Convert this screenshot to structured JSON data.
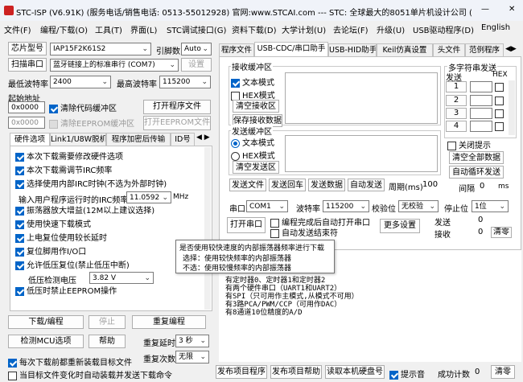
{
  "title": "STC-ISP (V6.91K) (服务电话/销售电话: 0513-55012928) 官网:www.STCAI.com  --- STC: 全球最大的8051单片机设计公司 (",
  "window_controls": {
    "min": "—",
    "max": "☐",
    "close": "✕"
  },
  "menu": [
    "文件(F)",
    "编程/下载(O)",
    "工具(T)",
    "界面(L)",
    "STC调试接口(G)",
    "资料下载(D)",
    "大学计划(U)",
    "去论坛(F)",
    "升级(U)",
    "USB驱动程序(D)",
    "English"
  ],
  "left": {
    "chip_btn": "芯片型号",
    "chip_value": "IAP15F2K61S2",
    "pins_label": "引脚数",
    "pins_value": "Auto",
    "scan_btn": "扫描串口",
    "port_value": "蓝牙链接上的标准串行 (COM7)",
    "settings_btn": "设置",
    "min_baud_label": "最低波特率",
    "min_baud": "2400",
    "max_baud_label": "最高波特率",
    "max_baud": "115200",
    "start_addr_label": "起始地址",
    "addr1": "0x0000",
    "clear_code": "清除代码缓冲区",
    "open_prog": "打开程序文件",
    "addr2": "0x0000",
    "clear_eeprom": "清除EEPROM缓冲区",
    "open_eeprom": "打开EEPROM文件",
    "hw_tabs": [
      "硬件选项",
      "Link1/U8W脱机",
      "程序加密后传输",
      "ID号"
    ],
    "options": [
      "本次下载需要修改硬件选项",
      "本次下载需调节IRC频率",
      "选择使用内部IRC时钟(不选为外部时钟)",
      "振荡器放大增益(12M以上建议选择)",
      "使用快速下载模式",
      "上电复位使用较长延时",
      "复位脚用作I/O口",
      "允许低压复位(禁止低压中断)",
      "低压时禁止EEPROM操作"
    ],
    "irc_label": "输入用户程序运行时的IRC频率",
    "irc_value": "11.0592",
    "irc_unit": "MHz",
    "lv_label": "低压检测电压",
    "lv_value": "3.82 V",
    "download_btn": "下载/编程",
    "stop_btn": "停止",
    "reprog_btn": "重复编程",
    "detect_btn": "检测MCU选项",
    "help_btn": "帮助",
    "delay_label": "重复延时",
    "delay_value": "3 秒",
    "count_label": "重复次数",
    "count_value": "无限",
    "reload_text": "每次下载前都重新装载目标文件",
    "auto_text": "当目标文件变化时自动装载并发送下载命令"
  },
  "right": {
    "tabs": [
      "程序文件",
      "USB-CDC/串口助手",
      "USB-HID助手",
      "Keil仿真设置",
      "头文件",
      "范例程序"
    ],
    "recv_title": "接收缓冲区",
    "recv_text": "文本模式",
    "recv_hex": "HEX模式",
    "clear_recv": "清空接收区",
    "save_recv": "保存接收数据",
    "send_title": "发送缓冲区",
    "send_text": "文本模式",
    "send_hex": "HEX模式",
    "clear_send": "清空发送区",
    "multi_title": "多字符串发送",
    "col_send": "发送",
    "col_hex": "HEX",
    "multi_rows": [
      "1",
      "2",
      "3",
      "4"
    ],
    "close_tip": "关闭提示",
    "clear_all": "清空全部数据",
    "auto_loop": "自动循环发送",
    "interval_label": "间隔",
    "interval_value": "0",
    "interval_unit": "ms",
    "send_file": "发送文件",
    "send_cr": "发送回车",
    "send_data": "发送数据",
    "auto_send": "自动发送",
    "period_label": "周期(ms)",
    "period_value": "100",
    "port_label": "串口",
    "port_value": "COM1",
    "baud_label": "波特率",
    "baud_value": "115200",
    "parity_label": "校验位",
    "parity_value": "无校验",
    "stop_label": "停止位",
    "stop_value": "1位",
    "open_port": "打开串口",
    "opt1": "编程完成后自动打开串口",
    "opt2": "自动发送结束符",
    "more": "更多设置",
    "tx_label": "发送",
    "tx_value": "0",
    "rx_label": "接收",
    "rx_value": "0",
    "clear_count": "清零",
    "tooltip_title": "是否使用较快速度的内部振荡器频率进行下载",
    "tooltip_l1": "选择：使用较快频率的内部振荡器",
    "tooltip_l2": "不选：使用较慢频率的内部振荡器",
    "log_lines": [
      "有定时器0、定时器1和定时器2",
      "有两个硬件串口（UART1和UART2）",
      "有SPI（只可用作主模式,从模式不可用）",
      "有3路PCA/PWM/CCP（可用作DAC）",
      "有8通道10位精度的A/D"
    ],
    "publish_prog": "发布项目程序",
    "publish_help": "发布项目帮助",
    "read_serial": "读取本机硬盘号",
    "tip_sound": "提示音",
    "success_label": "成功计数",
    "success_value": "0",
    "clear_bottom": "清零"
  }
}
